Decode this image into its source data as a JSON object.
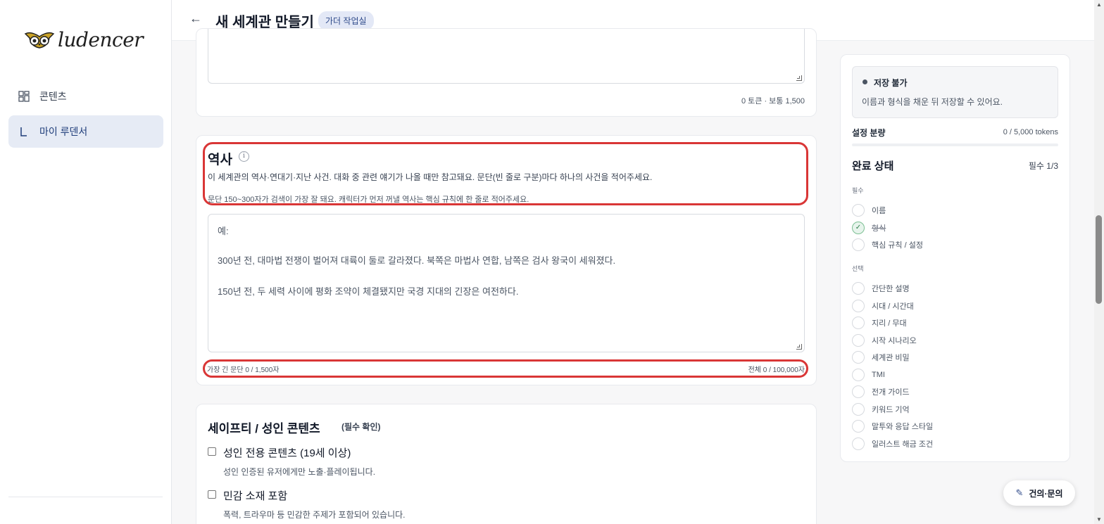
{
  "sidebar": {
    "logo_text": "ludencer",
    "items": [
      {
        "label": "콘텐츠",
        "icon": "grid-icon"
      },
      {
        "label": "마이 루덴서",
        "icon": "l-bracket-icon"
      }
    ]
  },
  "header": {
    "title": "새 세계관 만들기",
    "badge": "가더 작업실"
  },
  "prev_section": {
    "meta": "0 토큰 · 보통 1,500"
  },
  "history": {
    "title": "역사",
    "desc": "이 세계관의 역사·연대기·지난 사건. 대화 중 관련 얘기가 나올 때만 참고돼요. 문단(빈 줄로 구분)마다 하나의 사건을 적어주세요.",
    "hint": "문단 150~300자가 검색이 가장 잘 돼요. 캐릭터가 먼저 꺼낼 역사는 핵심 규칙에 한 줄로 적어주세요.",
    "placeholder_lines": [
      "예:",
      "300년 전, 대마법 전쟁이 벌어져 대륙이 둘로 갈라졌다. 북쪽은 마법사 연합, 남쪽은 검사 왕국이 세워졌다.",
      "150년 전, 두 세력 사이에 평화 조약이 체결됐지만 국경 지대의 긴장은 여전하다."
    ],
    "longest": "가장 긴 문단 0 / 1,500자",
    "total": "전체 0 / 100,000자"
  },
  "safety": {
    "title": "세이프티 / 성인 콘텐츠",
    "required_tag": "(필수 확인)",
    "options": [
      {
        "label": "성인 전용 콘텐츠 (19세 이상)",
        "sub": "성인 인증된 유저에게만 노출·플레이됩니다."
      },
      {
        "label": "민감 소재 포함",
        "sub": "폭력, 트라우마 등 민감한 주제가 포함되어 있습니다."
      }
    ]
  },
  "panel": {
    "status_title": "저장 불가",
    "status_desc": "이름과 형식을 채운 뒤 저장할 수 있어요.",
    "progress_label": "설정 분량",
    "progress_value": "0 / 5,000 tokens",
    "progress_fraction": 0,
    "done_title": "완료 상태",
    "done_count": "필수 1/3",
    "required_label": "필수",
    "required_items": [
      {
        "label": "이름",
        "done": false
      },
      {
        "label": "형식",
        "done": true
      },
      {
        "label": "핵심 규칙 / 설정",
        "done": false
      }
    ],
    "optional_label": "선택",
    "optional_items": [
      {
        "label": "간단한 설명"
      },
      {
        "label": "시대 / 시간대"
      },
      {
        "label": "지리 / 무대"
      },
      {
        "label": "시작 시나리오"
      },
      {
        "label": "세계관 비밀"
      },
      {
        "label": "TMI"
      },
      {
        "label": "전개 가이드"
      },
      {
        "label": "키워드 기억"
      },
      {
        "label": "말투와 응답 스타일"
      },
      {
        "label": "일러스트 해금 조건"
      }
    ]
  },
  "help_button": "건의·문의"
}
